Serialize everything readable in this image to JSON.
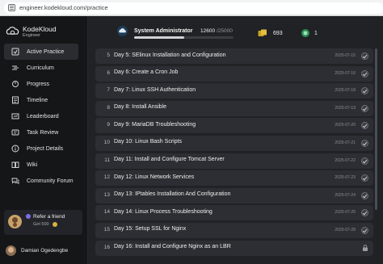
{
  "browser": {
    "url": "engineer.kodekloud.com/practice"
  },
  "brand": {
    "title": "KodeKloud",
    "subtitle": "Engineer"
  },
  "sidebar": {
    "items": [
      {
        "label": "Active Practice",
        "icon": "target-icon",
        "active": true
      },
      {
        "label": "Curriculum",
        "icon": "route-icon",
        "active": false
      },
      {
        "label": "Progress",
        "icon": "progress-icon",
        "active": false
      },
      {
        "label": "Timeline",
        "icon": "timeline-icon",
        "active": false
      },
      {
        "label": "Leaderboard",
        "icon": "leaderboard-icon",
        "active": false
      },
      {
        "label": "Task Review",
        "icon": "review-icon",
        "active": false
      },
      {
        "label": "Project Details",
        "icon": "info-icon",
        "active": false
      },
      {
        "label": "Wiki",
        "icon": "book-icon",
        "active": false
      },
      {
        "label": "Community Forum",
        "icon": "forum-icon",
        "active": false
      }
    ],
    "refer": {
      "title": "Refer a friend",
      "subtitle": "Get 500"
    },
    "user": {
      "name": "Damian Ogedengbe"
    }
  },
  "stats": {
    "rank": "System Administrator",
    "xp_current": "12600",
    "xp_max": "/25000",
    "xp_fraction": 0.504,
    "coins": "693",
    "badges": "1"
  },
  "tasks": [
    {
      "num": "5",
      "name": "Day 5: SElinux Installation and Configuration",
      "date": "2025-07-15",
      "status": "done"
    },
    {
      "num": "6",
      "name": "Day 6: Create a Cron Job",
      "date": "2025-07-16",
      "status": "done"
    },
    {
      "num": "7",
      "name": "Day 7: Linux SSH Authentication",
      "date": "2025-07-18",
      "status": "done"
    },
    {
      "num": "8",
      "name": "Day 8: Install Ansible",
      "date": "2025-07-19",
      "status": "done"
    },
    {
      "num": "9",
      "name": "Day 9: MariaDB Troubleshooting",
      "date": "2025-07-20",
      "status": "done"
    },
    {
      "num": "10",
      "name": "Day 10: Linux Bash Scripts",
      "date": "2025-07-21",
      "status": "done"
    },
    {
      "num": "11",
      "name": "Day 11: Install and Configure Tomcat Server",
      "date": "2025-07-22",
      "status": "done"
    },
    {
      "num": "12",
      "name": "Day 12: Linux Network Services",
      "date": "2025-07-23",
      "status": "done"
    },
    {
      "num": "13",
      "name": "Day 13: IPtables Installation And Configuration",
      "date": "2025-07-24",
      "status": "done"
    },
    {
      "num": "14",
      "name": "Day 14: Linux Process Troubleshooting",
      "date": "2025-07-25",
      "status": "done"
    },
    {
      "num": "15",
      "name": "Day 15: Setup SSL for Nginx",
      "date": "2025-07-28",
      "status": "done"
    },
    {
      "num": "16",
      "name": "Day 16: Install and Configure Nginx as an LBR",
      "date": "",
      "status": "locked"
    }
  ],
  "colors": {
    "background": "#202225",
    "sidebar": "#151618",
    "row": "#2c2e33",
    "coin": "#d8b23e",
    "badge": "#3cb371"
  }
}
